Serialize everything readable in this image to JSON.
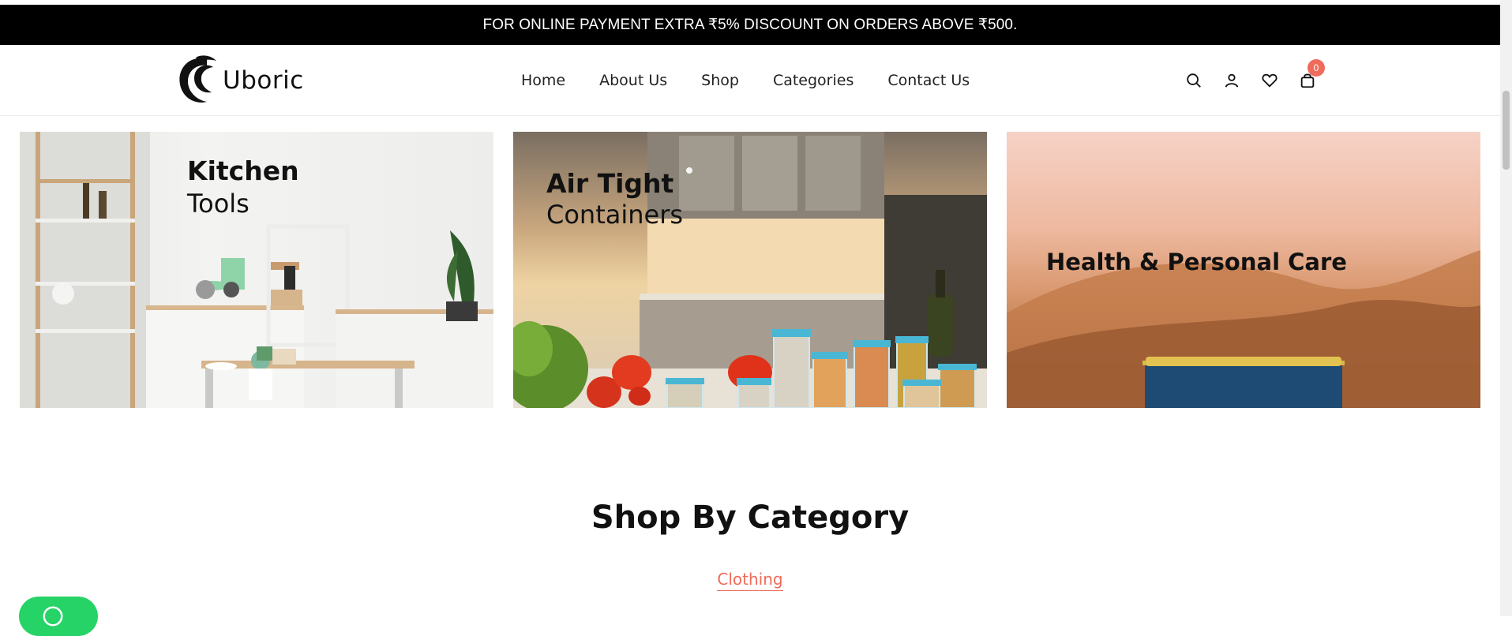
{
  "announcement": "FOR ONLINE PAYMENT EXTRA ₹5% DISCOUNT ON ORDERS ABOVE ₹500.",
  "brand": {
    "name": "Uboric"
  },
  "nav": {
    "items": [
      "Home",
      "About Us",
      "Shop",
      "Categories",
      "Contact Us"
    ]
  },
  "header_icons": [
    "search-icon",
    "user-icon",
    "heart-icon",
    "cart-icon"
  ],
  "cart": {
    "count": "0"
  },
  "banners": [
    {
      "title": "Kitchen",
      "subtitle": "Tools"
    },
    {
      "title": "Air Tight",
      "subtitle": "Containers"
    },
    {
      "title": "Health & Personal Care"
    }
  ],
  "section": {
    "title": "Shop By Category",
    "active_tab": "Clothing"
  },
  "colors": {
    "accent": "#ef6b5b",
    "announcement_bg": "#000000",
    "whatsapp": "#25d366"
  }
}
